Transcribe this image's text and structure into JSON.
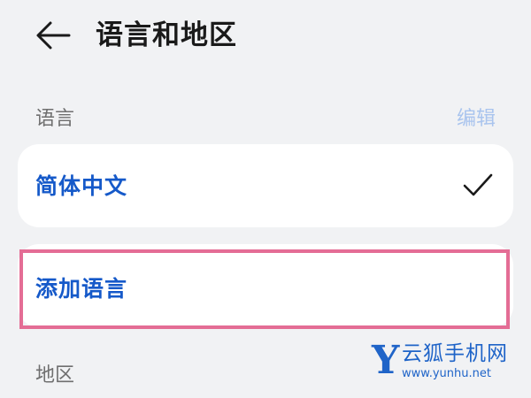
{
  "header": {
    "title": "语言和地区"
  },
  "language_section": {
    "label": "语言",
    "edit_label": "编辑",
    "current_language": "简体中文",
    "add_language_label": "添加语言"
  },
  "region_section": {
    "label": "地区"
  },
  "watermark": {
    "letter": "Y",
    "name": "云狐手机网",
    "url": "www.yunhu.net"
  },
  "icons": {
    "back": "arrow-left-icon",
    "selected": "checkmark-icon"
  },
  "colors": {
    "background": "#f1f2f4",
    "card": "#ffffff",
    "accent": "#1559c9",
    "edit_disabled": "#a9c4ee",
    "highlight": "#e46d95"
  }
}
